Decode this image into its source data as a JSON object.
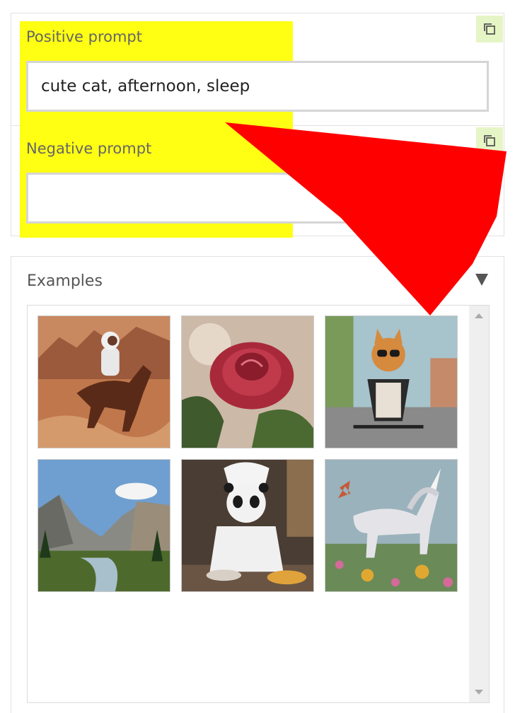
{
  "prompts": {
    "positive": {
      "label": "Positive prompt",
      "value": "cute cat, afternoon, sleep",
      "copy_icon": "copy-icon"
    },
    "negative": {
      "label": "Negative prompt",
      "value": "",
      "copy_icon": "copy-icon"
    }
  },
  "examples": {
    "title": "Examples",
    "toggle_icon": "caret-down-icon",
    "items": [
      {
        "name": "astronaut-horse-mars"
      },
      {
        "name": "red-rose"
      },
      {
        "name": "dog-sunglasses-bicycle"
      },
      {
        "name": "mountain-valley-river"
      },
      {
        "name": "panda-chef"
      },
      {
        "name": "white-unicorn-flowers"
      }
    ]
  },
  "annotations": {
    "highlight_color": "#ffff00",
    "arrow_color": "#ff0000"
  },
  "colors": {
    "copy_button_bg": "#e6f5c5",
    "border": "#e2e2e2"
  }
}
